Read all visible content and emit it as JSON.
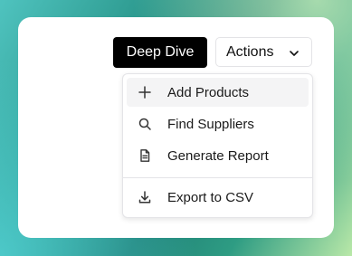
{
  "toolbar": {
    "deep_dive_label": "Deep Dive",
    "actions_label": "Actions"
  },
  "menu": {
    "items": [
      {
        "label": "Add Products",
        "icon": "plus-icon"
      },
      {
        "label": "Find Suppliers",
        "icon": "search-icon"
      },
      {
        "label": "Generate Report",
        "icon": "document-icon"
      },
      {
        "label": "Export to CSV",
        "icon": "download-icon"
      }
    ]
  },
  "colors": {
    "primary_button_bg": "#000000",
    "menu_hover_bg": "#f4f4f5"
  }
}
